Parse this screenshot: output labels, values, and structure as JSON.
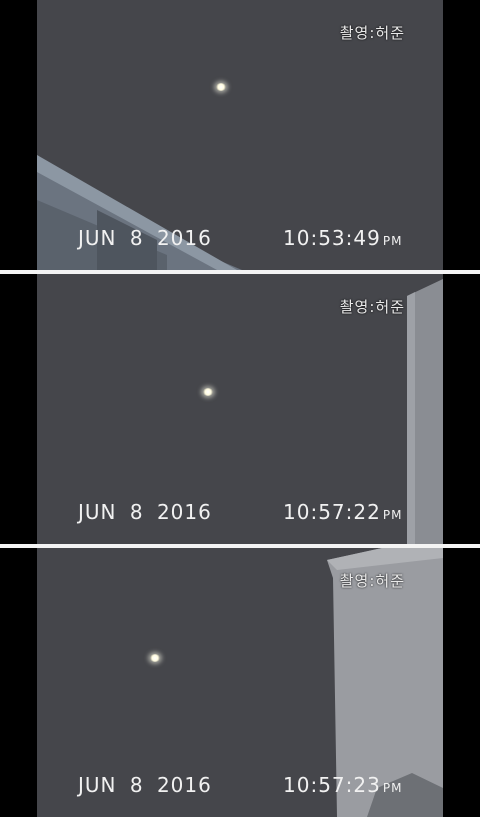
{
  "frames": [
    {
      "credit": "촬영:허준",
      "date": "JUN  8 2016",
      "time": "10:53:49",
      "meridiem": "PM"
    },
    {
      "credit": "촬영:허준",
      "date": "JUN  8 2016",
      "time": "10:57:22",
      "meridiem": "PM"
    },
    {
      "credit": "촬영:허준",
      "date": "JUN  8 2016",
      "time": "10:57:23",
      "meridiem": "PM"
    }
  ]
}
